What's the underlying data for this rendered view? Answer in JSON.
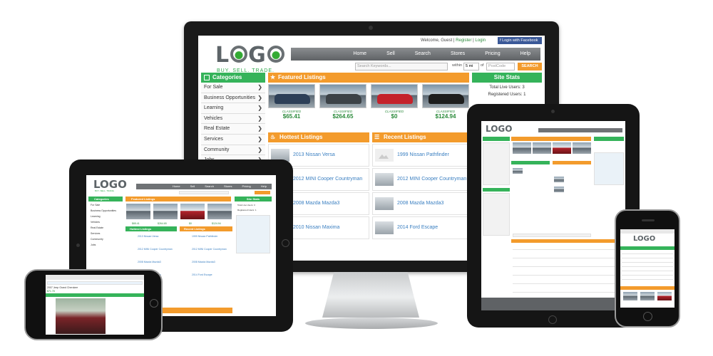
{
  "colors": {
    "accent_green": "#35b35a",
    "accent_orange": "#f39b2c",
    "nav_gray": "#6f7275",
    "link_blue": "#3a7fc1",
    "facebook_blue": "#3b5998"
  },
  "header": {
    "logo": "LOGO",
    "tagline": "BUY. SELL. TRADE.",
    "welcome": "Welcome, Guest",
    "register": "Register",
    "login": "Login",
    "facebook": "Login with Facebook",
    "nav": [
      "Home",
      "Sell",
      "Search",
      "Stores",
      "Pricing",
      "Help"
    ]
  },
  "search": {
    "placeholder": "Search Keywords...",
    "within_label": "within",
    "distance": "5 mi",
    "of_label": "of",
    "zip_placeholder": "PostCode",
    "button": "SEARCH"
  },
  "categories": {
    "title": "Categories",
    "items": [
      "For Sale",
      "Business Opportunities",
      "Learning",
      "Vehicles",
      "Real Estate",
      "Services",
      "Community",
      "Jobs"
    ]
  },
  "featured": {
    "title": "Featured Listings",
    "cards": [
      {
        "badge": "CLASSIFIED",
        "price": "$65.41",
        "color": "#2d3f58"
      },
      {
        "badge": "CLASSIFIED",
        "price": "$264.65",
        "color": "#3c4247"
      },
      {
        "badge": "CLASSIFIED",
        "price": "$0",
        "color": "#c4222b"
      },
      {
        "badge": "CLASSIFIED",
        "price": "$124.94",
        "color": "#1e1e1e"
      }
    ]
  },
  "site_stats": {
    "title": "Site Stats",
    "rows": [
      "Total Live Users: 3",
      "Registered Users: 1"
    ]
  },
  "hottest": {
    "title": "Hottest Listings",
    "items": [
      "2013 Nissan Versa",
      "2012 MINI Cooper Countryman",
      "2008 Mazda Mazda3",
      "2010 Nissan Maxima"
    ]
  },
  "recent": {
    "title": "Recent Listings",
    "items": [
      "1999 Nissan Pathfinder",
      "2012 MINI Cooper Countryman",
      "2008 Mazda Mazda3",
      "2014 Ford Escape"
    ]
  }
}
